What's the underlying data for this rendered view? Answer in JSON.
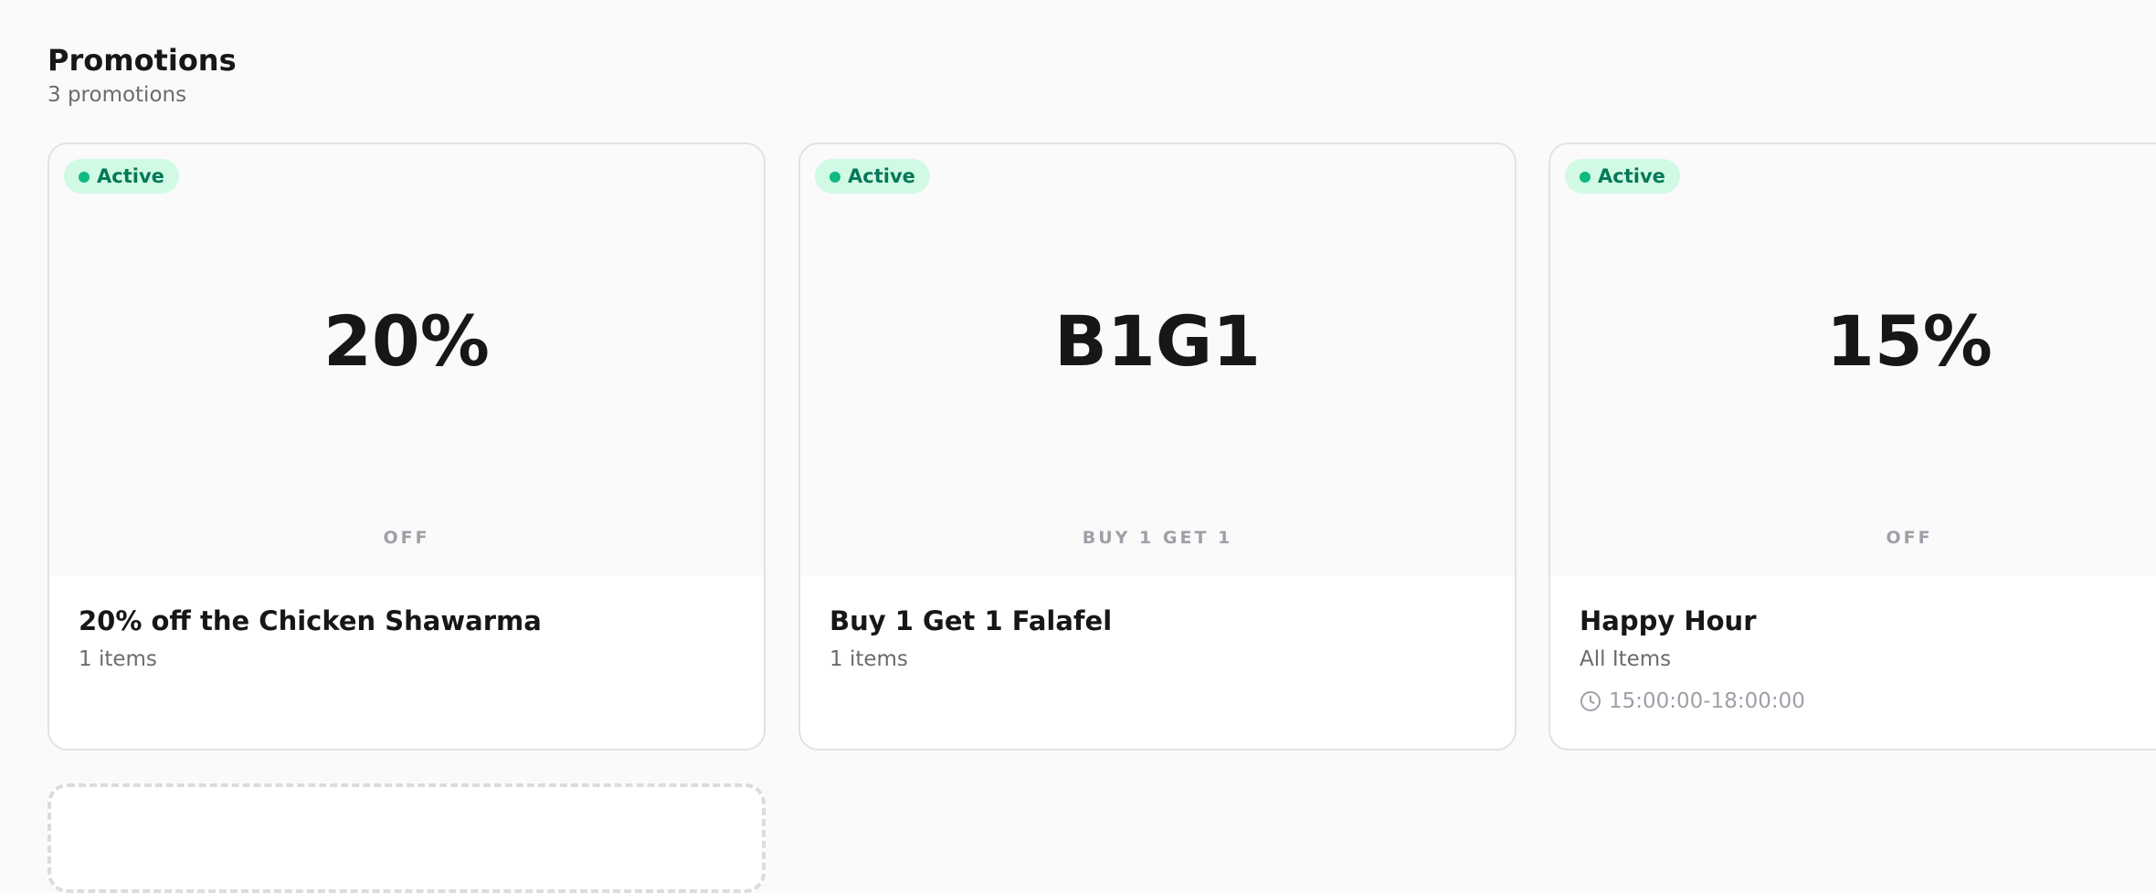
{
  "header": {
    "title": "Promotions",
    "subtitle": "3 promotions"
  },
  "promotions": [
    {
      "status": "Active",
      "value": "20%",
      "caption": "OFF",
      "name": "20% off the Chicken Shawarma",
      "scope": "1 items"
    },
    {
      "status": "Active",
      "value": "B1G1",
      "caption": "BUY 1 GET 1",
      "name": "Buy 1 Get 1 Falafel",
      "scope": "1 items"
    },
    {
      "status": "Active",
      "value": "15%",
      "caption": "OFF",
      "name": "Happy Hour",
      "scope": "All Items",
      "time": "15:00:00-18:00:00"
    }
  ],
  "colors": {
    "active_badge_bg": "#d1fae5",
    "active_badge_text": "#047857",
    "active_dot": "#10b981"
  }
}
